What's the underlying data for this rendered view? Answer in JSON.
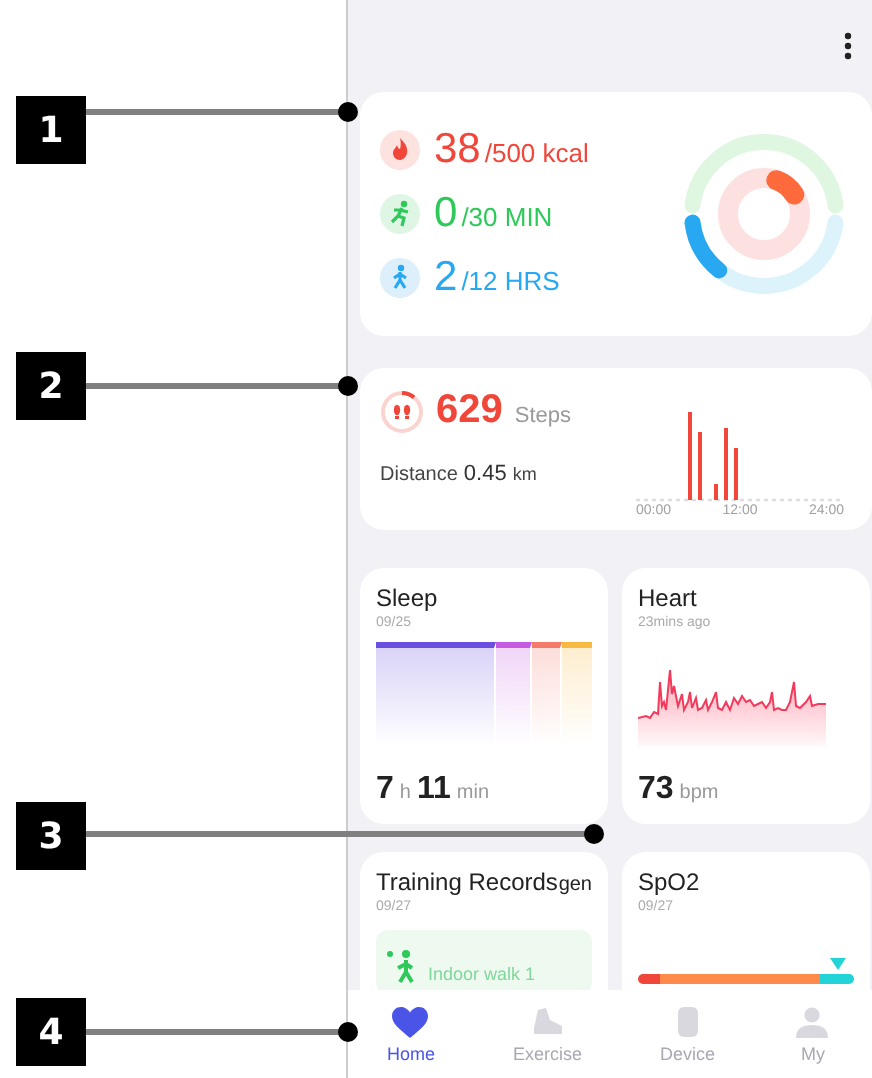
{
  "callouts": [
    {
      "number": "1"
    },
    {
      "number": "2"
    },
    {
      "number": "3"
    },
    {
      "number": "4"
    }
  ],
  "activity": {
    "metrics": [
      {
        "kind": "calories",
        "value": "38",
        "goal": "/500 kcal",
        "color": "#f0473a"
      },
      {
        "kind": "exercise",
        "value": "0",
        "goal": "/30 MIN",
        "color": "#2fc85a"
      },
      {
        "kind": "standing",
        "value": "2",
        "goal": "/12 HRS",
        "color": "#27a8f0"
      }
    ]
  },
  "steps": {
    "value": "629",
    "unit": "Steps",
    "distance_label": "Distance",
    "distance_value": "0.45",
    "distance_unit": "km",
    "axis_labels": [
      "00:00",
      "12:00",
      "24:00"
    ]
  },
  "sleep": {
    "title": "Sleep",
    "date": "09/25",
    "hours": "7",
    "hours_unit": "h",
    "minutes": "11",
    "minutes_unit": "min"
  },
  "heart": {
    "title": "Heart",
    "time": "23mins ago",
    "value": "73",
    "unit": "bpm"
  },
  "training": {
    "title": "Training Records",
    "overflow_text": "gen",
    "date": "09/27",
    "record": "Indoor walk 1"
  },
  "spo2": {
    "title": "SpO2",
    "date": "09/27"
  },
  "nav": [
    {
      "kind": "home",
      "label": "Home",
      "selected": true
    },
    {
      "kind": "exercise",
      "label": "Exercise",
      "selected": false
    },
    {
      "kind": "device",
      "label": "Device",
      "selected": false
    },
    {
      "kind": "my",
      "label": "My",
      "selected": false
    }
  ]
}
